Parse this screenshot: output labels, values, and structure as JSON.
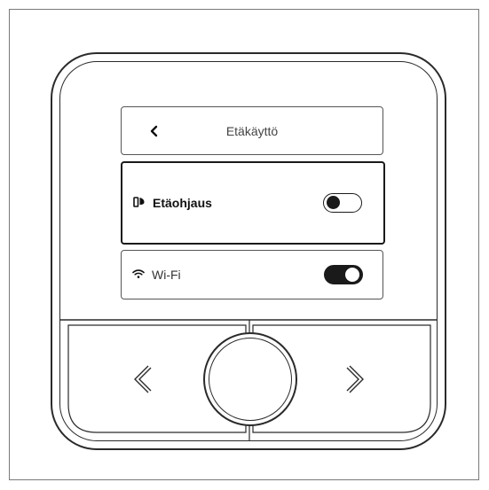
{
  "header": {
    "title": "Etäkäyttö"
  },
  "rows": [
    {
      "label": "Etäohjaus",
      "icon": "remote-control-icon",
      "toggle_state": "off"
    },
    {
      "label": "Wi-Fi",
      "icon": "wifi-icon",
      "toggle_state": "on"
    }
  ],
  "buttons": {
    "left": "chevron-left-icon",
    "center": "center-select-button",
    "right": "chevron-right-icon"
  },
  "colors": {
    "ink": "#1a1a1a",
    "background": "#ffffff",
    "border": "#555555"
  }
}
